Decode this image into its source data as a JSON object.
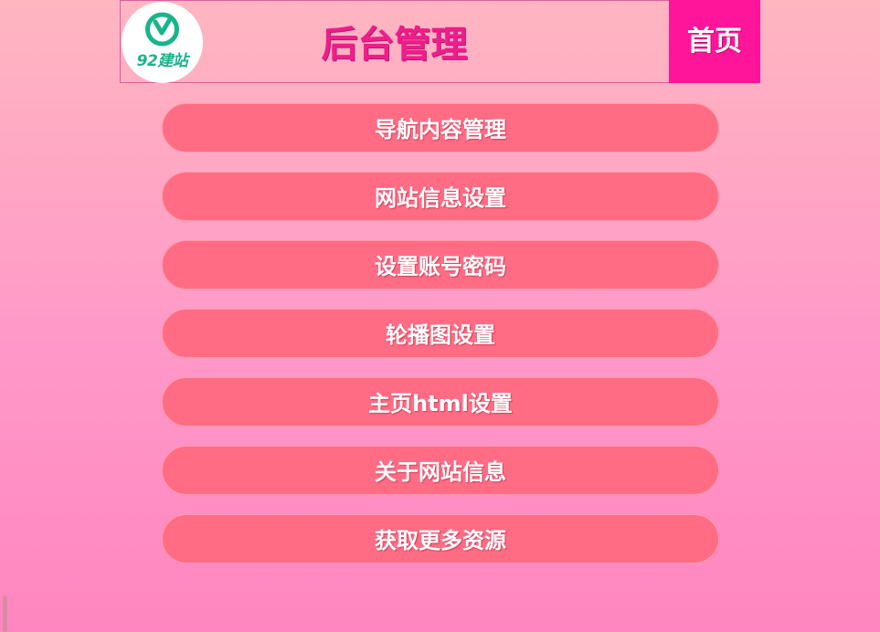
{
  "header": {
    "logo_text": "92建站",
    "title": "后台管理",
    "home_label": "首页"
  },
  "menu": {
    "items": [
      {
        "label": "导航内容管理"
      },
      {
        "label": "网站信息设置"
      },
      {
        "label": "设置账号密码"
      },
      {
        "label": "轮播图设置"
      },
      {
        "label": "主页html设置"
      },
      {
        "label": "关于网站信息"
      },
      {
        "label": "获取更多资源"
      }
    ]
  },
  "colors": {
    "title": "#ee1d8c",
    "home_button": "#ff159a",
    "menu_button": "#ff6c84",
    "logo_green": "#19b48c"
  }
}
